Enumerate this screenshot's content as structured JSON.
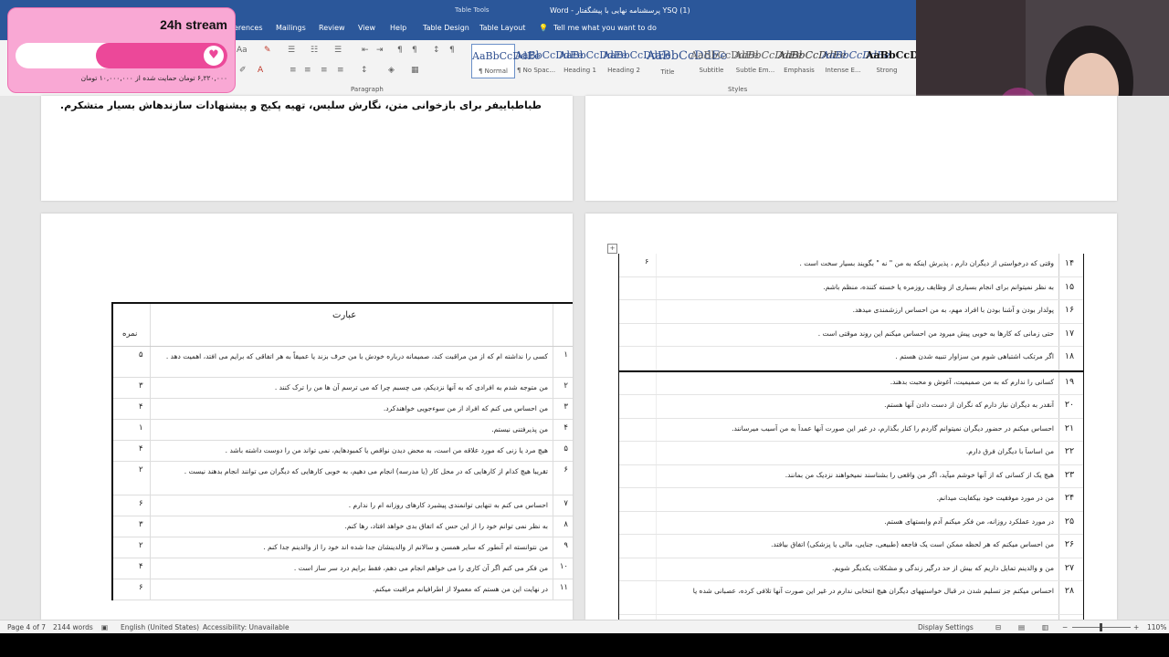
{
  "ribbon": {
    "tabs": [
      "erences",
      "Mailings",
      "Review",
      "View",
      "Help",
      "Table Design",
      "Table Layout"
    ],
    "tell_me": "Tell me what you want to do",
    "table_tools": "Table Tools",
    "doc_title": "YSQ (1) پرسشنامه نهایی با پیشگفتار - Word",
    "paragraph_label": "Paragraph",
    "styles_label": "Styles",
    "styles": [
      {
        "preview": "AaBbCcDdEe",
        "name": "¶ Normal"
      },
      {
        "preview": "AaBbCcDdEe",
        "name": "¶ No Spac..."
      },
      {
        "preview": "AaBbCcDdEe",
        "name": "Heading 1"
      },
      {
        "preview": "AaBbCcDdEe",
        "name": "Heading 2"
      },
      {
        "preview": "AaBbCcDdEe",
        "name": "Title"
      },
      {
        "preview": "AaBbCcDdEe",
        "name": "Subtitle"
      },
      {
        "preview": "AaBbCcDdEe",
        "name": "Subtle Em..."
      },
      {
        "preview": "AaBbCcDdEe",
        "name": "Emphasis"
      },
      {
        "preview": "AaBbCcDdEe",
        "name": "Intense E..."
      },
      {
        "preview": "AaBbCcDdEe",
        "name": "Strong"
      }
    ],
    "font_size_icon": "Aa"
  },
  "overlay": {
    "title": "24h stream",
    "caption": "۶,۲۲۰,۰۰۰ تومان حمایت شده از ۱۰,۰۰۰,۰۰۰ تومان",
    "progress": 0.62,
    "color": "#ec4899"
  },
  "document": {
    "thanks_text": "طباطباییفر برای بازخوانی متن، نگارش سلیس، تهیه پکیج و پیشنهادات سازندهاش بسیار متشکرم.",
    "left_table": {
      "header_expr": "عبارت",
      "header_score": "نمره",
      "rows": [
        {
          "n": "۱",
          "text": "کسی را نداشته ام که از من مراقبت کند، صمیمانه درباره خودش با من حرف بزند یا عمیقاً به هر اتفاقی که برایم می افتد، اهمیت دهد .",
          "score": "۵"
        },
        {
          "n": "۲",
          "text": "من متوجه شدم به افرادی که به آنها نزدیکم، می چسبم چرا که می ترسم آن ها من را ترک کنند .",
          "score": "۳"
        },
        {
          "n": "۳",
          "text": "من احساس می کنم که افراد از من سوءجویی خواهندکرد.",
          "score": "۴"
        },
        {
          "n": "۴",
          "text": "من پذیرفتنی نیستم.",
          "score": "۱"
        },
        {
          "n": "۵",
          "text": "هیچ مرد یا زنی که مورد علاقه من است، به محض دیدن نواقص یا کمبودهایم، نمی تواند من را دوست داشته باشد .",
          "score": "۴"
        },
        {
          "n": "۶",
          "text": "تقریبا هیچ کدام از کارهایی که در محل کار (یا مدرسه) انجام می دهیم، به خوبی کارهایی که دیگران می توانند انجام بدهند نیست .",
          "score": "۲"
        },
        {
          "n": "۷",
          "text": "احساس می کنم به تنهایی توانمندی پیشبرد کارهای روزانه ام را ندارم .",
          "score": "۶"
        },
        {
          "n": "۸",
          "text": "به نظر نمی توانم خود را از این حس که اتفاق بدی خواهد افتاد، رها کنم.",
          "score": "۳"
        },
        {
          "n": "۹",
          "text": "من نتوانسته ام آنطور که سایر همسن و سالانم از والدینشان جدا شده اند خود را از والدینم جدا کنم .",
          "score": "۲"
        },
        {
          "n": "۱۰",
          "text": "من فکر می کنم اگر آن کاری را می خواهم انجام می دهم، فقط برایم درد سر ساز است .",
          "score": "۴"
        },
        {
          "n": "۱۱",
          "text": "در نهایت این من هستم که معمولا از اطرافیانم مراقبت میکنم.",
          "score": "۶"
        }
      ]
    },
    "right_table": {
      "cursor_value": "۶",
      "rows_top": [
        {
          "n": "۱۴",
          "text": "وقتی که درخواستی از دیگران دارم ، پذیرش اینکه به من \" نه \" بگویند بسیار سخت است ."
        },
        {
          "n": "۱۵",
          "text": "به نظر نمیتوانم برای انجام بسیاری از وظایف روزمره یا خسته کننده، منظم باشم."
        },
        {
          "n": "۱۶",
          "text": "پولدار بودن و آشنا بودن با افراد مهم، به من احساس ارزشمندی میدهد."
        },
        {
          "n": "۱۷",
          "text": "حتی زمانی که کارها به خوبی پیش میرود من احساس میکنم این روند موقتی است ."
        },
        {
          "n": "۱۸",
          "text": "اگر مرتکب اشتباهی شوم من سزاوار تنبیه شدن هستم ."
        }
      ],
      "rows_bottom": [
        {
          "n": "۱۹",
          "text": "کسانی را ندارم که به من صمیمیت، آغوش و محبت بدهند."
        },
        {
          "n": "۲۰",
          "text": "آنقدر به دیگران نیاز دارم که نگران از دست دادن آنها هستم."
        },
        {
          "n": "۲۱",
          "text": "احساس میکنم در حضور دیگران نمیتوانم گاردم را کنار بگذارم، در غیر این صورت آنها عمداً به من آسیب میرسانند."
        },
        {
          "n": "۲۲",
          "text": "من اساساً با دیگران فرق دارم."
        },
        {
          "n": "۲۳",
          "text": "هیچ یک از کسانی که از آنها خوشم میآید، اگر من واقعی را بشناسند نمیخواهند نزدیک من بمانند."
        },
        {
          "n": "۲۴",
          "text": "من در مورد موفقیت خود بیکفایت میدانم."
        },
        {
          "n": "۲۵",
          "text": "در مورد عملکرد روزانه، من فکر میکنم آدم وابستهای هستم."
        },
        {
          "n": "۲۶",
          "text": "من احساس میکنم که هر لحظه ممکن است یک فاجعه (طبیعی، جنایی، مالی یا پزشکی) اتفاق بیافتد."
        },
        {
          "n": "۲۷",
          "text": "من و والدینم تمایل داریم که بیش از حد درگیر زندگی و مشکلات یکدیگر شویم."
        },
        {
          "n": "۲۸",
          "text": "احساس میکنم جز تسلیم شدن در قبال خواستههای دیگران هیچ انتخابی ندارم در غیر این صورت آنها تلافی کرده، عصبانی شده یا"
        },
        {
          "n": "۲۹",
          "text": "من آدم خوبی هستم، چون بیشتر از خودم، به فکر دیگرانم."
        }
      ]
    }
  },
  "status": {
    "page": "Page 4 of 7",
    "words": "2144 words",
    "language": "English (United States)",
    "accessibility": "Accessibility: Unavailable",
    "display_settings": "Display Settings",
    "zoom": "110%"
  }
}
